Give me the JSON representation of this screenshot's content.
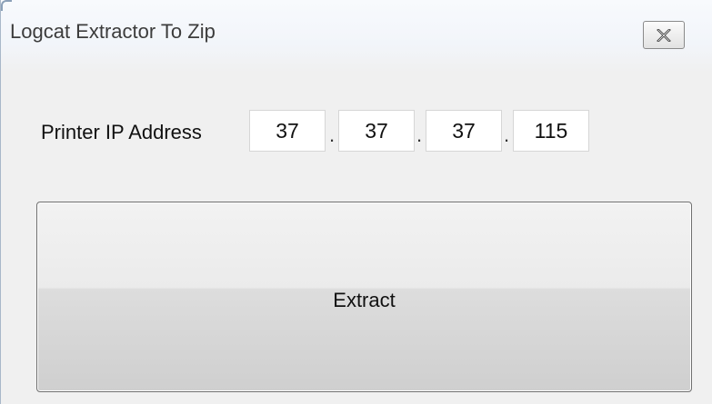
{
  "window": {
    "title": "Logcat Extractor To Zip"
  },
  "form": {
    "ip_label": "Printer IP Address",
    "ip_octets": [
      "37",
      "37",
      "37",
      "115"
    ],
    "separator": "."
  },
  "actions": {
    "extract_label": "Extract"
  },
  "icons": {
    "close": "close-icon"
  },
  "colors": {
    "window_bg": "#f0f0f0",
    "titlebar_bg": "#f8fafd"
  }
}
